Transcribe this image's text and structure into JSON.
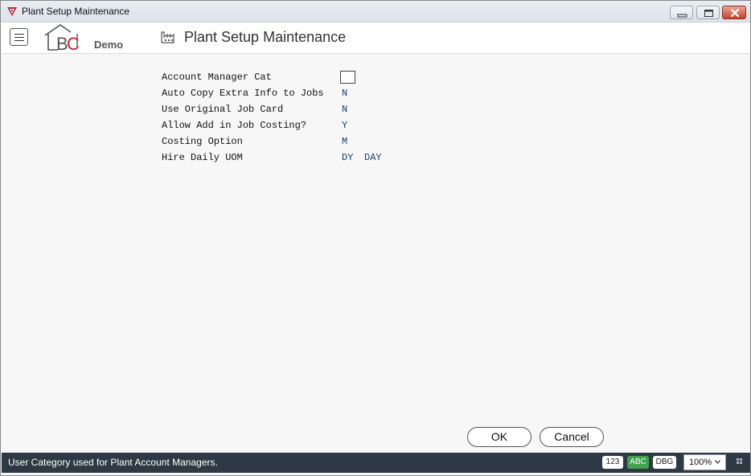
{
  "window": {
    "title": "Plant Setup Maintenance"
  },
  "header": {
    "logo_demo": "Demo",
    "title": "Plant Setup Maintenance"
  },
  "form": {
    "fields": [
      {
        "label": "Account Manager Cat",
        "value": "",
        "type": "checkbox"
      },
      {
        "label": "Auto Copy Extra Info to Jobs",
        "value": "N"
      },
      {
        "label": "Use Original Job Card",
        "value": "N"
      },
      {
        "label": "Allow Add in Job Costing?",
        "value": "Y"
      },
      {
        "label": "Costing Option",
        "value": "M"
      },
      {
        "label": "Hire Daily UOM",
        "value": "DY",
        "value2": "DAY"
      }
    ]
  },
  "buttons": {
    "ok": "OK",
    "cancel": "Cancel"
  },
  "statusbar": {
    "message": "User Category used for Plant Account Managers.",
    "mode_123": "123",
    "mode_abc": "ABC",
    "mode_dbg": "DBG",
    "zoom": "100%"
  },
  "colors": {
    "status_bg": "#2d3944",
    "value_text": "#1a3d7c",
    "abc_green": "#3fa34d",
    "logo_red": "#c8202e"
  },
  "icons": [
    "app-icon",
    "minimize-icon",
    "maximize-icon",
    "close-icon",
    "hamburger-menu-icon",
    "factory-icon",
    "chevron-down-icon",
    "resize-grip-icon"
  ]
}
